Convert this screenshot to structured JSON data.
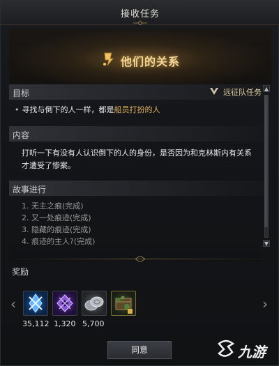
{
  "window": {
    "title": "接收任务"
  },
  "quest": {
    "title": "他们的关系"
  },
  "goal": {
    "header": "目标",
    "guild_tag": "远征队任务",
    "text_prefix": "寻找与倒下的人一样，都是",
    "text_highlight": "船员打扮的人",
    "bullet": "•"
  },
  "content": {
    "header": "内容",
    "text": "打听一下有没有人认识倒下的人的身份，是否因为和克林斯内有关系才遭受了惨案。"
  },
  "story": {
    "header": "故事进行",
    "items": [
      "1. 无主之痕(完成)",
      "2. 又一处痕迹(完成)",
      "3. 隐藏的痕迹(完成)",
      "4. 痕迹的主人?(完成)"
    ]
  },
  "scrollbar": {
    "up": "▲",
    "down": "▼"
  },
  "rewards": {
    "label": "奖励",
    "nav_left": "‹",
    "nav_right": "›",
    "items": [
      {
        "icon": "blue-crystal-icon",
        "count": "35,112",
        "color": "#1d5fa6"
      },
      {
        "icon": "purple-gem-icon",
        "count": "1,320",
        "color": "#5a2e9a"
      },
      {
        "icon": "silver-coins-icon",
        "count": "5,700",
        "color": "#8a8d93"
      },
      {
        "icon": "mossy-chest-icon",
        "count": "",
        "color": "#3e4a2c"
      }
    ]
  },
  "agree_button": "同意",
  "watermark": {
    "text": "九游"
  },
  "colors": {
    "accent": "#e5b35a",
    "title_glow": "#f2d79a"
  }
}
